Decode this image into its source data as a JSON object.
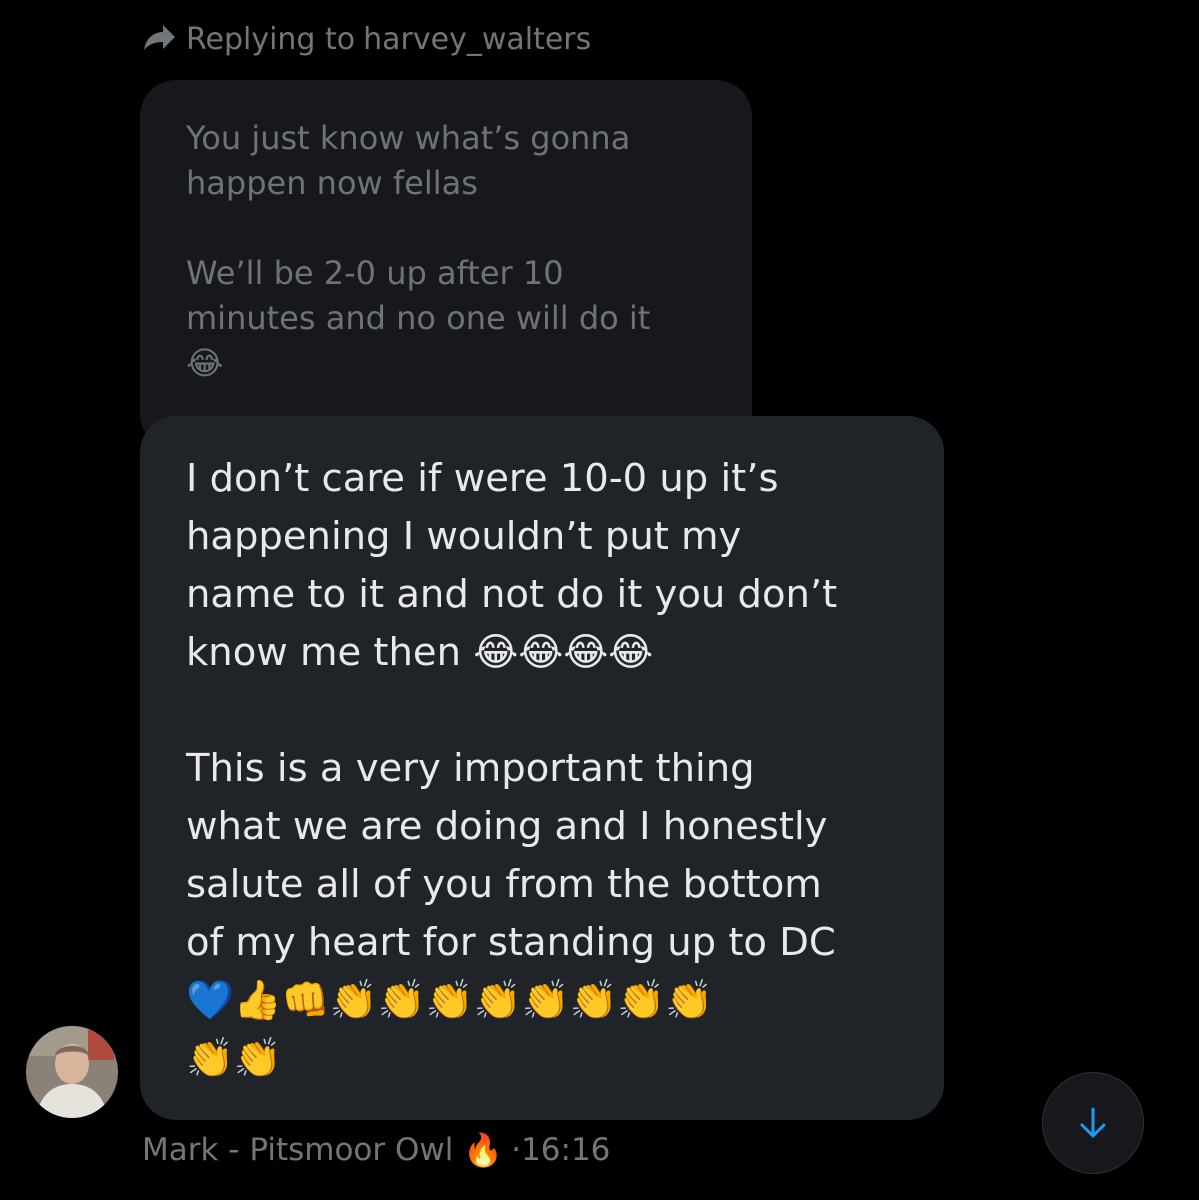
{
  "reply_context": {
    "prefix": "Replying to",
    "username": "harvey_walters",
    "icon": "reply-arrow-icon"
  },
  "quoted_message": {
    "paragraph_1": "You just know what’s gonna\nhappen now fellas",
    "paragraph_2": "We’ll be 2-0 up after 10\nminutes and no one will do it\n😂"
  },
  "message": {
    "paragraph_1": "I don’t care if were 10-0 up it’s\nhappening I wouldn’t put my\nname to it and not do it you don’t\nknow me then 😂😂😂😂",
    "paragraph_2": "This is a very important thing\nwhat we are doing and I honestly\nsalute all of you from the bottom\nof my heart for standing up to DC\n💙👍👊👏👏👏👏👏👏👏👏\n👏👏"
  },
  "sender": {
    "name": "Mark - Pitsmoor Owl",
    "name_emoji": "🔥",
    "timestamp": "·16:16",
    "avatar": "avatar-photo"
  },
  "scroll_button": {
    "icon": "arrow-down-icon"
  },
  "colors": {
    "background": "#000000",
    "bubble": "#202327",
    "quoted_bubble": "#16181c",
    "muted_text": "#71767b",
    "accent": "#1d9bf0"
  }
}
